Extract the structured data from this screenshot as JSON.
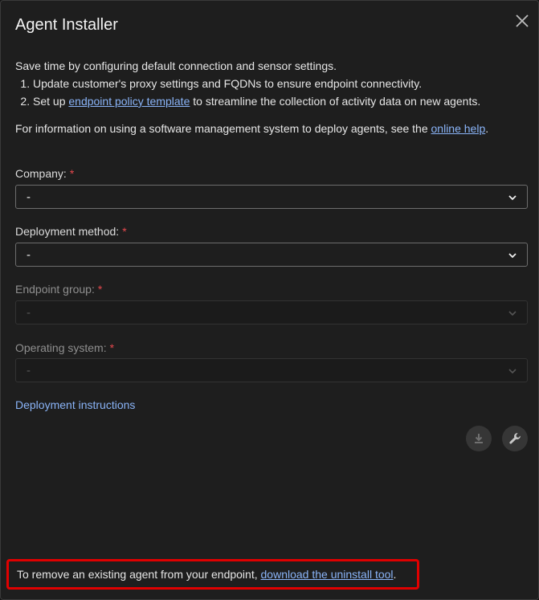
{
  "dialog": {
    "title": "Agent Installer"
  },
  "intro": {
    "lead": "Save time by configuring default connection and sensor settings.",
    "step1": "Update customer's proxy settings and FQDNs to ensure endpoint connectivity.",
    "step2_prefix": "Set up ",
    "step2_link": "endpoint policy template",
    "step2_suffix": " to streamline the collection of activity data on new agents.",
    "info_prefix": "For information on using a software management system to deploy agents, see the ",
    "info_link": "online help",
    "info_suffix": "."
  },
  "form": {
    "required_marker": "*",
    "company": {
      "label": "Company:",
      "value": "-"
    },
    "deployment_method": {
      "label": "Deployment method:",
      "value": "-"
    },
    "endpoint_group": {
      "label": "Endpoint group:",
      "value": "-"
    },
    "operating_system": {
      "label": "Operating system:",
      "value": "-"
    }
  },
  "deployment_instructions": "Deployment instructions",
  "footer": {
    "prefix": "To remove an existing agent from your endpoint, ",
    "link": "download the uninstall tool",
    "suffix": "."
  },
  "icons": {
    "close": "close-icon",
    "chevron": "chevron-down-icon",
    "download": "download-icon",
    "wrench": "wrench-icon"
  },
  "colors": {
    "link": "#8ab4f8",
    "required": "#e5484d",
    "highlight_border": "#e00000",
    "background": "#1e1e1e"
  }
}
